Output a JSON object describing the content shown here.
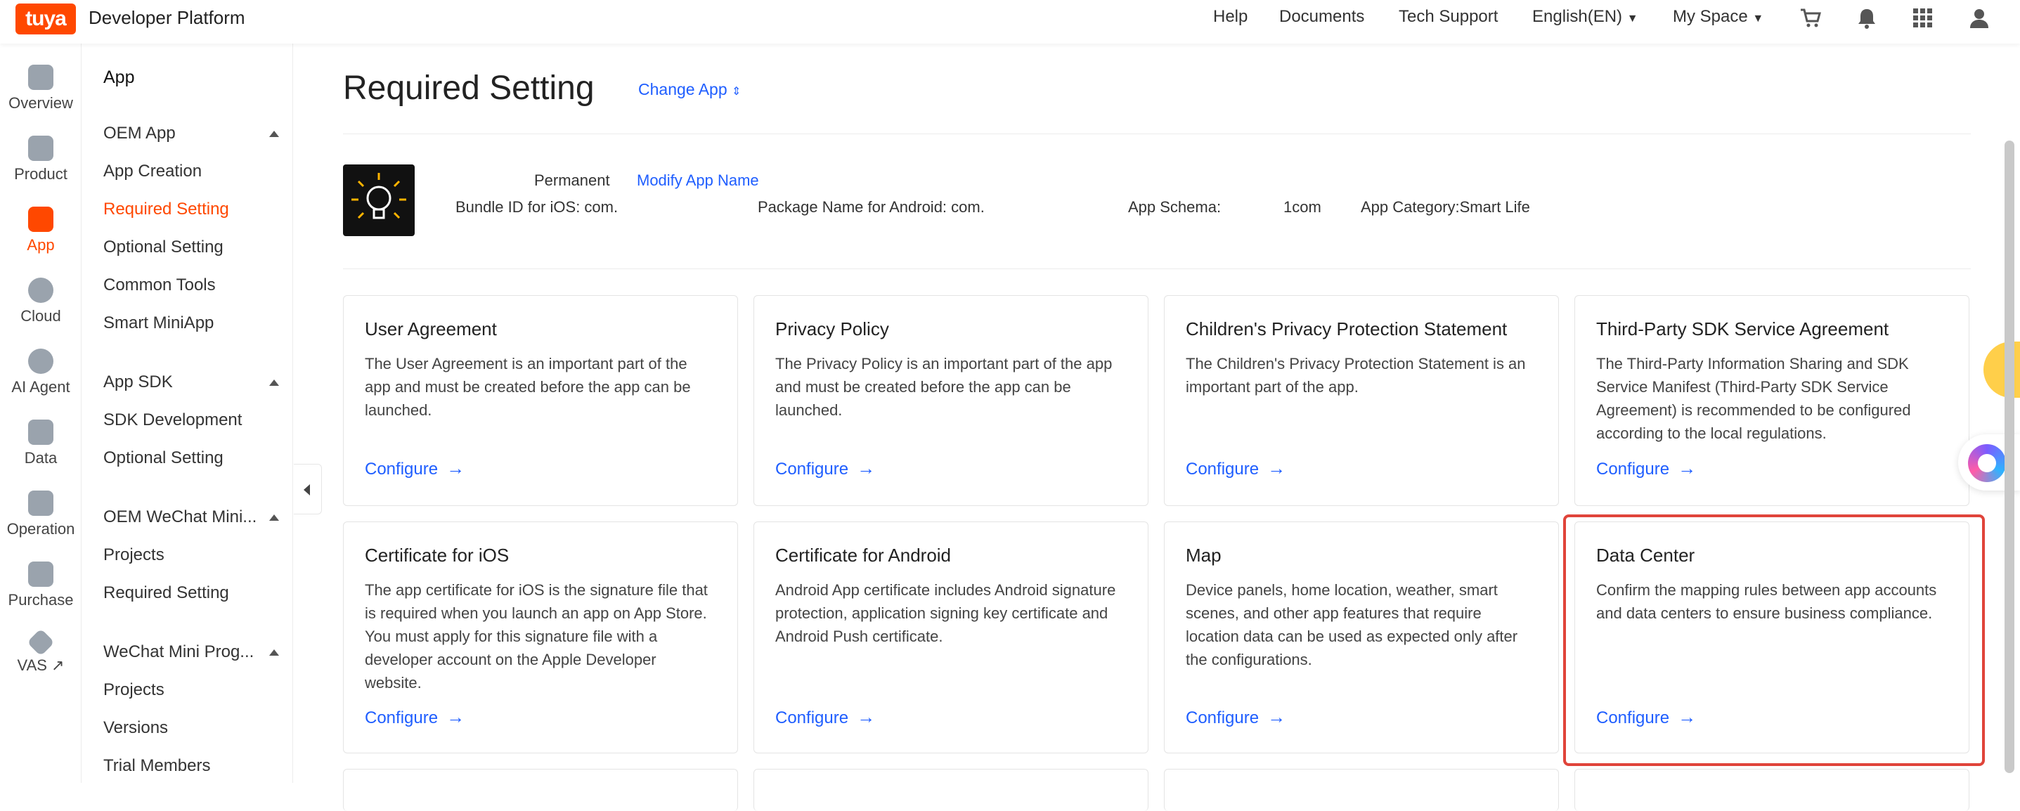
{
  "header": {
    "logo_text": "tuya",
    "brand": "Developer Platform",
    "nav": [
      "Help",
      "Documents",
      "Tech Support",
      "English(EN)",
      "My Space"
    ],
    "icons": [
      "cart-icon",
      "bell-icon",
      "apps-grid-icon",
      "user-icon"
    ],
    "brand_color": "#ff4800"
  },
  "rail": [
    {
      "label": "Overview",
      "icon": "home-icon"
    },
    {
      "label": "Product",
      "icon": "product-icon"
    },
    {
      "label": "App",
      "icon": "app-icon",
      "active": true
    },
    {
      "label": "Cloud",
      "icon": "cloud-icon"
    },
    {
      "label": "AI Agent",
      "icon": "ai-agent-icon"
    },
    {
      "label": "Data",
      "icon": "data-icon"
    },
    {
      "label": "Operation",
      "icon": "operation-icon"
    },
    {
      "label": "Purchase",
      "icon": "purchase-icon"
    },
    {
      "label": "VAS ↗",
      "icon": "vas-icon"
    }
  ],
  "subnav": {
    "title": "App",
    "groups": [
      {
        "label": "OEM App",
        "items": [
          "App Creation",
          "Required Setting",
          "Optional Setting",
          "Common Tools",
          "Smart MiniApp"
        ]
      },
      {
        "label": "App SDK",
        "items": [
          "SDK Development",
          "Optional Setting"
        ]
      },
      {
        "label": "OEM WeChat Mini...",
        "items": [
          "Projects",
          "Required Setting"
        ]
      },
      {
        "label": "WeChat Mini Prog...",
        "items": [
          "Projects",
          "Versions",
          "Trial Members"
        ]
      }
    ],
    "active_item": "Required Setting"
  },
  "page": {
    "title": "Required Setting",
    "change_app": "Change App"
  },
  "app_info": {
    "name_tag": "Permanent",
    "modify": "Modify App Name",
    "bundle_id": "Bundle ID for iOS: com.",
    "package_name": "Package Name for Android: com.",
    "schema_label": "App Schema:",
    "schema_value": "1com",
    "category": "App Category:Smart Life"
  },
  "cards": [
    {
      "title": "User Agreement",
      "desc": "The User Agreement is an important part of the app and must be created before the app can be launched.",
      "action": "Configure"
    },
    {
      "title": "Privacy Policy",
      "desc": "The Privacy Policy is an important part of the app and must be created before the app can be launched.",
      "action": "Configure"
    },
    {
      "title": "Children's Privacy Protection Statement",
      "desc": "The Children's Privacy Protection Statement is an important part of the app.",
      "action": "Configure"
    },
    {
      "title": "Third-Party SDK Service Agreement",
      "desc": "The Third-Party Information Sharing and SDK Service Manifest (Third-Party SDK Service Agreement) is recommended to be configured according to the local regulations.",
      "action": "Configure"
    },
    {
      "title": "Certificate for iOS",
      "desc": "The app certificate for iOS is the signature file that is required when you launch an app on App Store. You must apply for this signature file with a developer account on the Apple Developer website.",
      "action": "Configure"
    },
    {
      "title": "Certificate for Android",
      "desc": "Android App certificate includes Android signature protection, application signing key certificate and Android Push certificate.",
      "action": "Configure"
    },
    {
      "title": "Map",
      "desc": "Device panels, home location, weather, smart scenes, and other app features that require location data can be used as expected only after the configurations.",
      "action": "Configure"
    },
    {
      "title": "Data Center",
      "desc": "Confirm the mapping rules between app accounts and data centers to ensure business compliance.",
      "action": "Configure",
      "highlighted": true
    }
  ],
  "accent": "#1f5eff",
  "highlight_color": "#e0443a"
}
